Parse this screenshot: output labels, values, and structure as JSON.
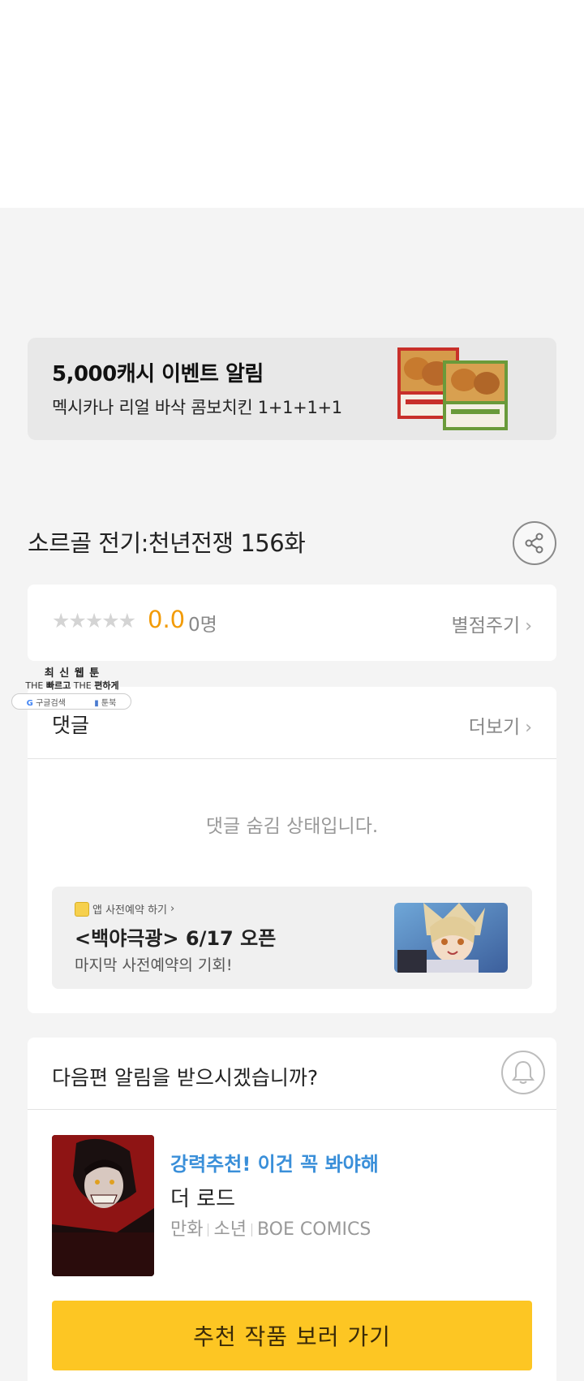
{
  "event": {
    "title": "5,000캐시 이벤트 알림",
    "subtitle": "멕시카나 리얼 바삭 콤보치킨 1+1+1+1"
  },
  "episode": {
    "title": "소르골 전기:천년전쟁 156화"
  },
  "rating": {
    "stars": "★★★★★",
    "score": "0.0",
    "count": "0명",
    "rate_link": "별점주기"
  },
  "comments": {
    "header": "댓글",
    "more_link": "더보기",
    "hidden_message": "댓글 숨김 상태입니다."
  },
  "promo": {
    "small_label": "앱 사전예약 하기",
    "title": "<백야극광> 6/17 오픈",
    "subtitle": "마지막 사전예약의 기회!"
  },
  "overlay_badge": {
    "line1": "최 신 웹 툰",
    "line2_a": "THE",
    "line2_b": "빠르고",
    "line2_c": "THE",
    "line2_d": "편하게",
    "pill_left": "구글검색",
    "pill_right": "툰북"
  },
  "next": {
    "question": "다음편 알림을 받으시겠습니까?",
    "rec_tag": "강력추천! 이건 꼭 봐야해",
    "rec_title": "더 로드",
    "rec_meta": [
      "만화",
      "소년",
      "BOE COMICS"
    ],
    "button_label": "추천 작품 보러 가기"
  },
  "colors": {
    "accent_yellow": "#fdc623",
    "score_orange": "#f29b06",
    "link_blue": "#3a8fd9"
  }
}
